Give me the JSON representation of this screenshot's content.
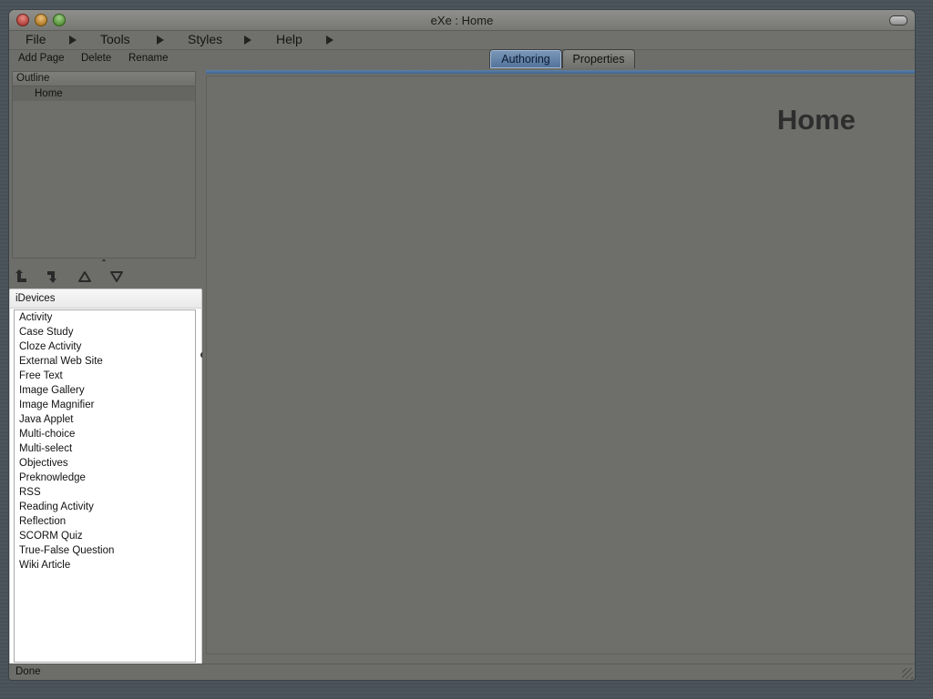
{
  "window": {
    "title": "eXe : Home"
  },
  "menubar": {
    "items": [
      "File",
      "Tools",
      "Styles",
      "Help"
    ]
  },
  "actionbar": {
    "add_page": "Add Page",
    "delete": "Delete",
    "rename": "Rename"
  },
  "tabs": {
    "authoring": "Authoring",
    "properties": "Properties",
    "active": "Authoring"
  },
  "outline": {
    "header": "Outline",
    "nodes": [
      "Home"
    ],
    "selected": "Home"
  },
  "nav_icons": [
    "promote-icon",
    "demote-icon",
    "move-up-icon",
    "move-down-icon"
  ],
  "idevices": {
    "header": "iDevices",
    "items": [
      "Activity",
      "Case Study",
      "Cloze Activity",
      "External Web Site",
      "Free Text",
      "Image Gallery",
      "Image Magnifier",
      "Java Applet",
      "Multi-choice",
      "Multi-select",
      "Objectives",
      "Preknowledge",
      "RSS",
      "Reading Activity",
      "Reflection",
      "SCORM Quiz",
      "True-False Question",
      "Wiki Article"
    ]
  },
  "content": {
    "heading": "Home"
  },
  "status": {
    "text": "Done"
  },
  "colors": {
    "active_tab": "#5f80a6",
    "window_bg": "#6d6e69",
    "panel_white": "#ffffff"
  }
}
